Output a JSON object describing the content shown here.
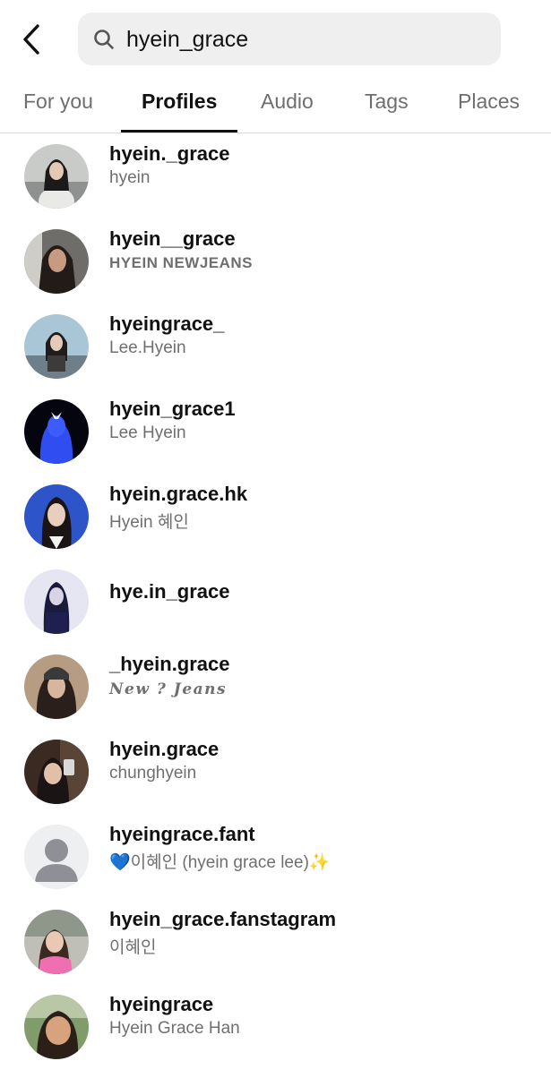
{
  "search": {
    "query": "hyein_grace"
  },
  "tabs": [
    {
      "label": "For you"
    },
    {
      "label": "Profiles"
    },
    {
      "label": "Audio"
    },
    {
      "label": "Tags"
    },
    {
      "label": "Places"
    }
  ],
  "results": [
    {
      "username": "hyein._grace",
      "fullname": "hyein"
    },
    {
      "username": "hyein__grace",
      "fullname": "HYEIN NEWJEANS"
    },
    {
      "username": "hyeingrace_",
      "fullname": "Lee.Hyein"
    },
    {
      "username": "hyein_grace1",
      "fullname": "Lee Hyein"
    },
    {
      "username": "hyein.grace.hk",
      "fullname": "Hyein 혜인"
    },
    {
      "username": "hye.in_grace",
      "fullname": ""
    },
    {
      "username": "_hyein.grace",
      "fullname": "New ? Jeans"
    },
    {
      "username": "hyein.grace",
      "fullname": "chunghyein"
    },
    {
      "username": "hyeingrace.fant",
      "fullname": "💙이혜인 (hyein grace lee)✨"
    },
    {
      "username": "hyein_grace.fanstagram",
      "fullname": "이혜인"
    },
    {
      "username": "hyeingrace",
      "fullname": "Hyein Grace Han"
    }
  ]
}
